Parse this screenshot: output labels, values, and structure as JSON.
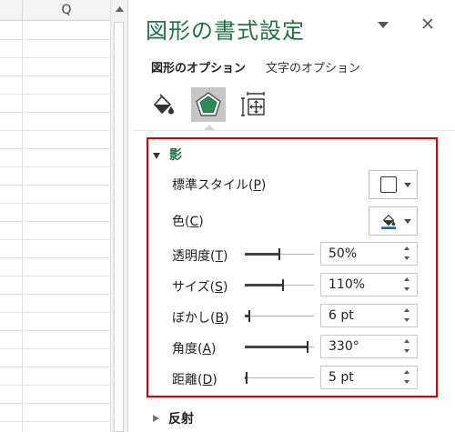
{
  "sheet": {
    "column_header": "Q"
  },
  "pane": {
    "title": "図形の書式設定",
    "tabs": [
      {
        "label": "図形のオプション",
        "active": true
      },
      {
        "label": "文字のオプション",
        "active": false
      }
    ],
    "icons": [
      "fill-line-icon",
      "effects-icon",
      "size-properties-icon"
    ],
    "accent_color": "#217346",
    "highlight_color": "#e00000",
    "shadow_section": {
      "title": "影",
      "expanded": true,
      "preset": {
        "label": "標準スタイル(P)",
        "label_main": "標準スタイル(",
        "label_key": "P",
        "label_end": ")"
      },
      "color": {
        "label": "色(C)",
        "label_main": "色(",
        "label_key": "C",
        "label_end": ")",
        "swatch": "#0070c0"
      },
      "transparency": {
        "label_main": "透明度(",
        "label_key": "T",
        "label_end": ")",
        "value": "50%",
        "level": 0.5
      },
      "size": {
        "label_main": "サイズ(",
        "label_key": "S",
        "label_end": ")",
        "value": "110%",
        "level": 0.55
      },
      "blur": {
        "label_main": "ぼかし(",
        "label_key": "B",
        "label_end": ")",
        "value": "6 pt",
        "level": 0.05
      },
      "angle": {
        "label_main": "角度(",
        "label_key": "A",
        "label_end": ")",
        "value": "330°",
        "level": 0.92
      },
      "distance": {
        "label_main": "距離(",
        "label_key": "D",
        "label_end": ")",
        "value": "5 pt",
        "level": 0.02
      }
    },
    "next_section": {
      "title": "反射",
      "expanded": false
    }
  }
}
